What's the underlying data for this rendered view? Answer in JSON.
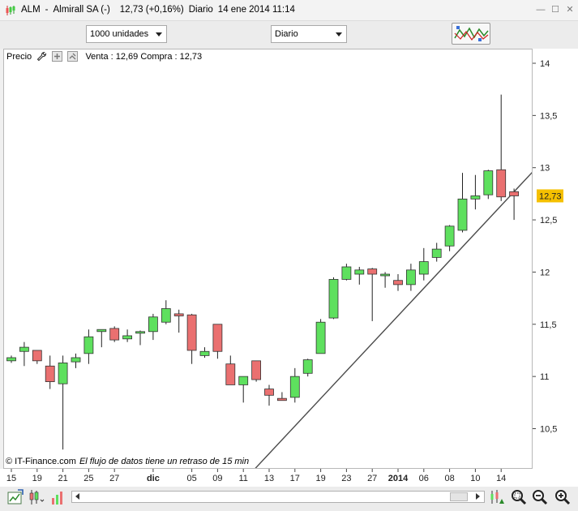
{
  "window": {
    "ticker": "ALM",
    "name": "Almirall SA (-)",
    "price_change": "12,73 (+0,16%)",
    "period": "Diario",
    "datetime": "14 ene 2014 11:14"
  },
  "toolbar": {
    "units_select": "1000 unidades",
    "period_select": "Diario"
  },
  "legend": {
    "label": "Precio",
    "quote": "Venta : 12,69 Compra : 12,73"
  },
  "footer": {
    "copyright": "© IT-Finance.com",
    "delay_note": "El flujo de datos tiene un retraso de 15 min"
  },
  "colors": {
    "up": "#5ee05e",
    "down": "#ea7070",
    "last_price_bg": "#f5c000",
    "trendline": "#4a4a4a"
  },
  "chart_data": {
    "type": "candlestick",
    "ylim": [
      10.05,
      14.05
    ],
    "yticks": [
      "14",
      "13,5",
      "13",
      "12,5",
      "12",
      "11,5",
      "11",
      "10,5"
    ],
    "ytick_values": [
      14,
      13.5,
      13,
      12.5,
      12,
      11.5,
      11,
      10.5
    ],
    "last_price_label": "12,73",
    "last_price": 12.73,
    "xticks": [
      {
        "label": "15",
        "index": 0
      },
      {
        "label": "19",
        "index": 2
      },
      {
        "label": "21",
        "index": 4
      },
      {
        "label": "25",
        "index": 6
      },
      {
        "label": "27",
        "index": 8
      },
      {
        "label": "dic",
        "index": 11,
        "bold": true
      },
      {
        "label": "05",
        "index": 14
      },
      {
        "label": "09",
        "index": 16
      },
      {
        "label": "11",
        "index": 18
      },
      {
        "label": "13",
        "index": 20
      },
      {
        "label": "17",
        "index": 22
      },
      {
        "label": "19",
        "index": 24
      },
      {
        "label": "23",
        "index": 26
      },
      {
        "label": "27",
        "index": 28
      },
      {
        "label": "2014",
        "index": 30,
        "bold": true
      },
      {
        "label": "06",
        "index": 32
      },
      {
        "label": "08",
        "index": 34
      },
      {
        "label": "10",
        "index": 36
      },
      {
        "label": "14",
        "index": 38
      }
    ],
    "candles": [
      {
        "o": 11.15,
        "h": 11.2,
        "l": 11.13,
        "c": 11.18
      },
      {
        "o": 11.24,
        "h": 11.33,
        "l": 11.1,
        "c": 11.28
      },
      {
        "o": 11.25,
        "h": 11.25,
        "l": 11.12,
        "c": 11.15
      },
      {
        "o": 11.1,
        "h": 11.2,
        "l": 10.88,
        "c": 10.95
      },
      {
        "o": 10.93,
        "h": 11.2,
        "l": 10.3,
        "c": 11.13
      },
      {
        "o": 11.14,
        "h": 11.22,
        "l": 11.08,
        "c": 11.18
      },
      {
        "o": 11.22,
        "h": 11.45,
        "l": 11.12,
        "c": 11.38
      },
      {
        "o": 11.43,
        "h": 11.45,
        "l": 11.28,
        "c": 11.45
      },
      {
        "o": 11.46,
        "h": 11.48,
        "l": 11.33,
        "c": 11.35
      },
      {
        "o": 11.36,
        "h": 11.45,
        "l": 11.33,
        "c": 11.39
      },
      {
        "o": 11.42,
        "h": 11.44,
        "l": 11.3,
        "c": 11.43
      },
      {
        "o": 11.43,
        "h": 11.6,
        "l": 11.35,
        "c": 11.57
      },
      {
        "o": 11.52,
        "h": 11.73,
        "l": 11.5,
        "c": 11.65
      },
      {
        "o": 11.6,
        "h": 11.64,
        "l": 11.42,
        "c": 11.58
      },
      {
        "o": 11.59,
        "h": 11.6,
        "l": 11.12,
        "c": 11.25
      },
      {
        "o": 11.2,
        "h": 11.28,
        "l": 11.18,
        "c": 11.24
      },
      {
        "o": 11.5,
        "h": 11.5,
        "l": 11.17,
        "c": 11.24
      },
      {
        "o": 11.12,
        "h": 11.2,
        "l": 10.95,
        "c": 10.92
      },
      {
        "o": 10.92,
        "h": 11.0,
        "l": 10.75,
        "c": 11.0
      },
      {
        "o": 11.15,
        "h": 11.15,
        "l": 10.95,
        "c": 10.97
      },
      {
        "o": 10.88,
        "h": 10.92,
        "l": 10.72,
        "c": 10.82
      },
      {
        "o": 10.79,
        "h": 10.85,
        "l": 10.77,
        "c": 10.77
      },
      {
        "o": 10.8,
        "h": 11.08,
        "l": 10.75,
        "c": 11.0
      },
      {
        "o": 11.03,
        "h": 11.17,
        "l": 11.0,
        "c": 11.16
      },
      {
        "o": 11.22,
        "h": 11.55,
        "l": 11.22,
        "c": 11.52
      },
      {
        "o": 11.56,
        "h": 11.95,
        "l": 11.55,
        "c": 11.93
      },
      {
        "o": 11.93,
        "h": 12.08,
        "l": 11.92,
        "c": 12.05
      },
      {
        "o": 11.98,
        "h": 12.05,
        "l": 11.88,
        "c": 12.02
      },
      {
        "o": 12.03,
        "h": 12.04,
        "l": 11.53,
        "c": 11.98
      },
      {
        "o": 11.97,
        "h": 12.0,
        "l": 11.85,
        "c": 11.98
      },
      {
        "o": 11.92,
        "h": 11.98,
        "l": 11.82,
        "c": 11.88
      },
      {
        "o": 11.88,
        "h": 12.08,
        "l": 11.82,
        "c": 12.02
      },
      {
        "o": 11.98,
        "h": 12.23,
        "l": 11.92,
        "c": 12.1
      },
      {
        "o": 12.14,
        "h": 12.28,
        "l": 12.1,
        "c": 12.22
      },
      {
        "o": 12.25,
        "h": 12.45,
        "l": 12.2,
        "c": 12.44
      },
      {
        "o": 12.4,
        "h": 12.95,
        "l": 12.38,
        "c": 12.7
      },
      {
        "o": 12.7,
        "h": 12.93,
        "l": 12.6,
        "c": 12.73
      },
      {
        "o": 12.74,
        "h": 12.98,
        "l": 12.7,
        "c": 12.97
      },
      {
        "o": 12.98,
        "h": 13.7,
        "l": 12.68,
        "c": 12.72
      },
      {
        "o": 12.77,
        "h": 12.8,
        "l": 12.5,
        "c": 12.73
      }
    ],
    "trendline": [
      {
        "x": 18.4,
        "y": 10.05
      },
      {
        "x": 40.9,
        "y": 13.02
      }
    ],
    "grid": false,
    "legend_position": "top-left"
  }
}
